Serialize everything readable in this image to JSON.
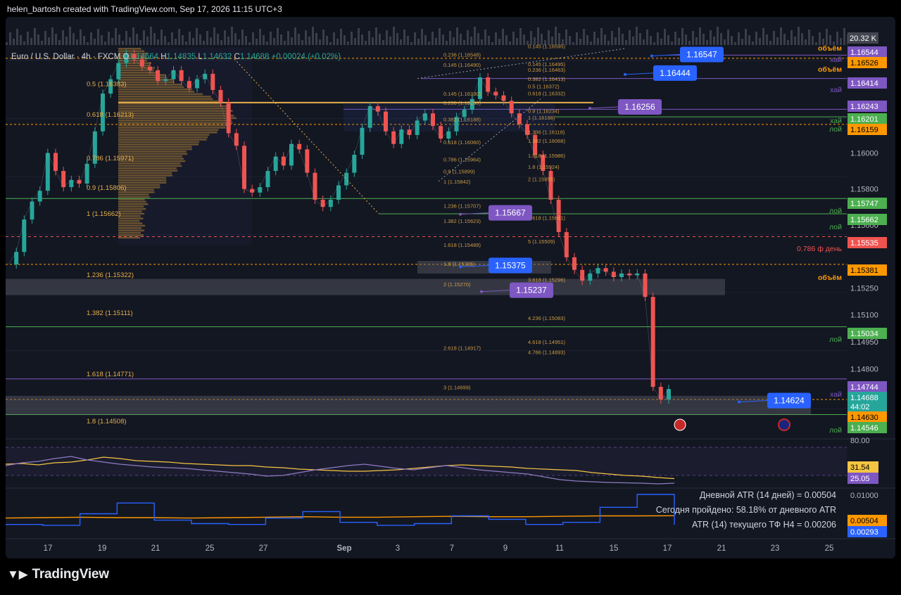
{
  "header": {
    "attribution": "helen_bartosh created with TradingView.com, Sep 17, 2026 11:15 UTC+3"
  },
  "legend": {
    "symbol": "Euro / U.S. Dollar · 4h · FXCM",
    "o_label": "O",
    "o_value": "1.14664",
    "h_label": "H",
    "h_value": "1.14835",
    "l_label": "L",
    "l_value": "1.14632",
    "c_label": "C",
    "c_value": "1.14688",
    "change": "+0.00024 (+0.02%)"
  },
  "colors": {
    "background": "#131722",
    "up": "#26a69a",
    "down": "#ef5350",
    "support": "#4caf50",
    "resistance": "#7e57c2",
    "volume": "#ff9800",
    "fib": "#e8b04a",
    "callout": "#2962ff",
    "callout_purple": "#7e57c2"
  },
  "chart_data": [
    {
      "type": "line",
      "title": "",
      "x_ticks": [
        "17",
        "19",
        "21",
        "25",
        "27",
        "Sep",
        "3",
        "7",
        "9",
        "11",
        "15",
        "17",
        "21",
        "23",
        "25"
      ],
      "y_ticks": [
        "1.16000",
        "1.15800",
        "1.15600",
        "1.15250",
        "1.15100",
        "1.14950",
        "1.14800"
      ],
      "close_path_note": "",
      "series": [
        {
          "values": [
            [
              0,
              1.1538
            ],
            [
              1,
              1.1545
            ],
            [
              2,
              1.1563
            ],
            [
              3,
              1.1573
            ],
            [
              4,
              1.1579
            ],
            [
              5,
              1.16
            ],
            [
              6,
              1.159
            ],
            [
              7,
              1.1581
            ],
            [
              8,
              1.1585
            ],
            [
              9,
              1.1583
            ],
            [
              10,
              1.1594
            ],
            [
              11,
              1.1612
            ],
            [
              12,
              1.1633
            ],
            [
              13,
              1.1641
            ],
            [
              14,
              1.165
            ],
            [
              15,
              1.1655
            ],
            [
              16,
              1.1652
            ],
            [
              17,
              1.1648
            ],
            [
              18,
              1.1646
            ],
            [
              19,
              1.164
            ],
            [
              20,
              1.1641
            ],
            [
              21,
              1.1646
            ],
            [
              22,
              1.164
            ],
            [
              23,
              1.1636
            ],
            [
              24,
              1.1641
            ],
            [
              25,
              1.1644
            ],
            [
              26,
              1.1635
            ],
            [
              27,
              1.1628
            ],
            [
              28,
              1.1611
            ],
            [
              29,
              1.1604
            ],
            [
              30,
              1.158
            ],
            [
              31,
              1.1578
            ],
            [
              32,
              1.1581
            ],
            [
              33,
              1.159
            ],
            [
              34,
              1.1598
            ],
            [
              35,
              1.1593
            ],
            [
              36,
              1.1605
            ],
            [
              37,
              1.1602
            ],
            [
              38,
              1.1589
            ],
            [
              39,
              1.1574
            ],
            [
              40,
              1.157
            ],
            [
              41,
              1.1574
            ],
            [
              42,
              1.1582
            ],
            [
              43,
              1.1589
            ],
            [
              44,
              1.1599
            ],
            [
              45,
              1.1614
            ],
            [
              46,
              1.1626
            ],
            [
              47,
              1.1623
            ],
            [
              48,
              1.1612
            ],
            [
              49,
              1.1605
            ],
            [
              50,
              1.1613
            ],
            [
              51,
              1.161
            ],
            [
              52,
              1.1618
            ],
            [
              53,
              1.1622
            ],
            [
              54,
              1.1615
            ],
            [
              55,
              1.1608
            ],
            [
              56,
              1.1612
            ],
            [
              57,
              1.162
            ],
            [
              58,
              1.1624
            ],
            [
              59,
              1.163
            ],
            [
              60,
              1.1642
            ],
            [
              61,
              1.1634
            ],
            [
              62,
              1.1632
            ],
            [
              63,
              1.1629
            ],
            [
              64,
              1.1622
            ],
            [
              65,
              1.1616
            ],
            [
              66,
              1.161
            ],
            [
              67,
              1.1599
            ],
            [
              68,
              1.159
            ],
            [
              69,
              1.1574
            ],
            [
              70,
              1.1556
            ],
            [
              71,
              1.1542
            ],
            [
              72,
              1.1535
            ],
            [
              73,
              1.1529
            ],
            [
              74,
              1.1533
            ],
            [
              75,
              1.1536
            ],
            [
              76,
              1.1534
            ],
            [
              77,
              1.1531
            ],
            [
              78,
              1.1533
            ],
            [
              79,
              1.1532
            ],
            [
              80,
              1.1533
            ],
            [
              81,
              1.152
            ],
            [
              82,
              1.147
            ],
            [
              83,
              1.1463
            ],
            [
              84,
              1.14688
            ]
          ]
        }
      ],
      "price_labels": [
        {
          "value": "1.16544",
          "color": "#7e57c2"
        },
        {
          "value": "1.16526",
          "color": "#ff9800"
        },
        {
          "value": "1.16414",
          "color": "#7e57c2"
        },
        {
          "value": "1.16243",
          "color": "#7e57c2"
        },
        {
          "value": "1.16201",
          "color": "#4caf50"
        },
        {
          "value": "1.16159",
          "color": "#ff9800"
        },
        {
          "value": "1.15747",
          "color": "#4caf50"
        },
        {
          "value": "1.15662",
          "color": "#4caf50"
        },
        {
          "value": "1.15535",
          "color": "#ef5350"
        },
        {
          "value": "1.15381",
          "color": "#ff9800"
        },
        {
          "value": "1.15034",
          "color": "#4caf50"
        },
        {
          "value": "1.14744",
          "color": "#7e57c2"
        },
        {
          "value": "1.14688",
          "color": "#26a69a"
        },
        {
          "value": "44:02",
          "color": "#26a69a"
        },
        {
          "value": "1.14630",
          "color": "#ff9800"
        },
        {
          "value": "1.14546",
          "color": "#4caf50"
        }
      ],
      "level_tags": [
        {
          "text": "объём",
          "color": "#ff9800"
        },
        {
          "text": "хай",
          "color": "#7e57c2"
        },
        {
          "text": "объём",
          "color": "#ff9800"
        },
        {
          "text": "хай",
          "color": "#7e57c2"
        },
        {
          "text": "хай",
          "color": "#4caf50"
        },
        {
          "text": "лой",
          "color": "#4caf50"
        },
        {
          "text": "лой",
          "color": "#4caf50"
        },
        {
          "text": "лой",
          "color": "#4caf50"
        },
        {
          "text": "0.786 ф день",
          "color": "#ef5350"
        },
        {
          "text": "объём",
          "color": "#ff9800"
        },
        {
          "text": "лой",
          "color": "#4caf50"
        },
        {
          "text": "хай",
          "color": "#7e57c2"
        },
        {
          "text": "лой",
          "color": "#4caf50"
        }
      ],
      "callouts": [
        {
          "text": "1.16547",
          "color": "#2962ff"
        },
        {
          "text": "1.16444",
          "color": "#2962ff"
        },
        {
          "text": "1.16256",
          "color": "#7e57c2"
        },
        {
          "text": "1.15667",
          "color": "#7e57c2"
        },
        {
          "text": "1.15375",
          "color": "#2962ff"
        },
        {
          "text": "1.15237",
          "color": "#7e57c2"
        },
        {
          "text": "1.14624",
          "color": "#2962ff"
        }
      ],
      "fib_left": [
        "0.5 (1.16383)",
        "0.618 (1.16213)",
        "0.786 (1.15971)",
        "0.9 (1.15806)",
        "1 (1.15662)",
        "1.236 (1.15322)",
        "1.382 (1.15111)",
        "1.618 (1.14771)",
        "1.8 (1.14508)"
      ],
      "fib_mid": [
        "0.236 (1.16548)",
        "0.145 (1.16490)",
        "0.145 (1.16330)",
        "0.236 (1.16280)",
        "0.382 (1.16188)",
        "0.618 (1.16060)",
        "0.786 (1.15964)",
        "0.9 (1.15899)",
        "1 (1.15842)",
        "1.236 (1.15707)",
        "1.382 (1.15623)",
        "1.618 (1.15489)",
        "1.8 (1.15385)",
        "2 (1.15270)",
        "2.618 (1.14917)",
        "3 (1.14699)"
      ],
      "fib_right": [
        "0.145 (1.16595)",
        "0.145 (1.16495)",
        "0.236 (1.16463)",
        "0.382 (1.16413)",
        "0.5 (1.16372)",
        "0.618 (1.16332)",
        "0.9 (1.16234)",
        "1 (1.16198)",
        "1.236 (1.16118)",
        "1.382 (1.16068)",
        "1.618 (1.15986)",
        "1.8 (1.15924)",
        "2 (1.15855)",
        "3.618 (1.15641)",
        "5 (1.15509)",
        "3.618 (1.15296)",
        "4.236 (1.15083)",
        "4.618 (1.14951)",
        "4.786 (1.14893)"
      ]
    },
    {
      "type": "line",
      "title": "",
      "y_ticks": [
        "80.00"
      ],
      "values_labels": [
        "31.54",
        "25.05"
      ],
      "series": [
        {
          "values": [
            52,
            53,
            51,
            54,
            55,
            58,
            62,
            60,
            57,
            56,
            55,
            53,
            52,
            51,
            50,
            50,
            48,
            47,
            45,
            44,
            43,
            42,
            42,
            43,
            44,
            46,
            48,
            50,
            51,
            50,
            49,
            48,
            46,
            45,
            44,
            43,
            40,
            38,
            36,
            35,
            33,
            31.54
          ]
        },
        {
          "values": [
            50,
            54,
            56,
            60,
            63,
            58,
            55,
            52,
            50,
            48,
            47,
            46,
            44,
            42,
            40,
            38,
            35,
            36,
            40,
            44,
            47,
            50,
            52,
            49,
            46,
            44,
            47,
            50,
            47,
            44,
            42,
            40,
            38,
            34,
            30,
            28,
            27,
            26,
            25.5,
            25,
            24,
            25.05
          ]
        }
      ]
    },
    {
      "type": "line",
      "title": "",
      "y_ticks": [
        "0.01000"
      ],
      "annotations": [
        "Дневной ATR (14 дней) = 0.00504",
        "Сегодня пройдено: 58.18% от дневного ATR",
        "ATR (14) текущего ТФ H4 = 0.00206"
      ],
      "values_labels": [
        "0.00504",
        "0.00293"
      ],
      "series": [
        {
          "values": [
            0.0045,
            0.0046,
            0.0047,
            0.0046,
            0.0046,
            0.0045,
            0.0046,
            0.0047,
            0.0048,
            0.0047,
            0.0047,
            0.0048,
            0.0049,
            0.0048,
            0.0048,
            0.0049,
            0.005,
            0.005,
            0.00504
          ]
        },
        {
          "values": [
            0.003,
            0.0028,
            0.0055,
            0.008,
            0.004,
            0.0032,
            0.003,
            0.0045,
            0.006,
            0.0035,
            0.0028,
            0.0032,
            0.005,
            0.0042,
            0.003,
            0.0035,
            0.007,
            0.01,
            0.00293
          ]
        }
      ]
    }
  ],
  "volume_badge": "20.32 K",
  "brand": {
    "name": "TradingView"
  }
}
